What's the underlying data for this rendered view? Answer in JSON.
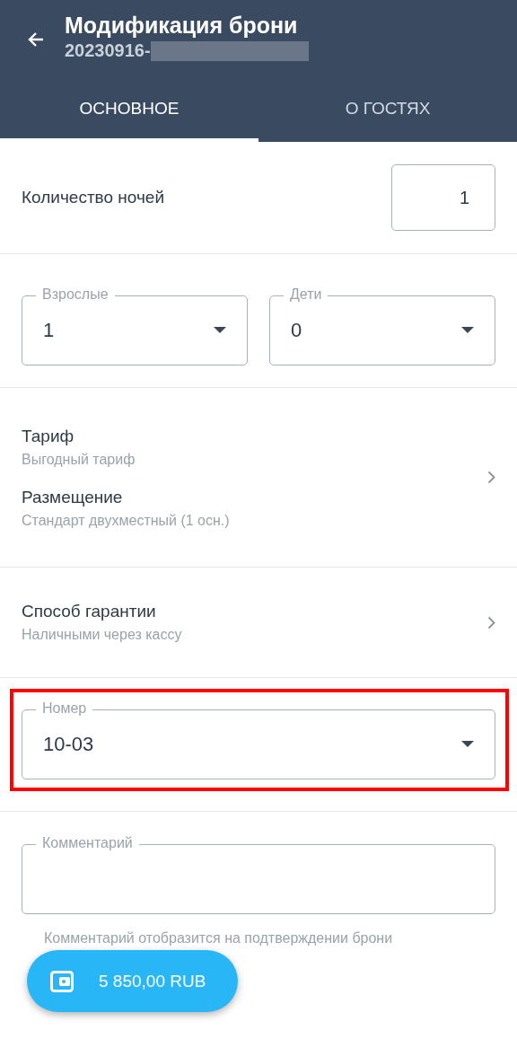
{
  "header": {
    "title": "Модификация брони",
    "subtitle": "20230916-"
  },
  "tabs": [
    {
      "label": "ОСНОВНОЕ",
      "selected": true
    },
    {
      "label": "О ГОСТЯХ",
      "selected": false
    }
  ],
  "nights": {
    "label": "Количество ночей",
    "value": "1"
  },
  "guests": [
    {
      "label": "Взрослые",
      "value": "1"
    },
    {
      "label": "Дети",
      "value": "0"
    }
  ],
  "rate_section": {
    "items": [
      {
        "label": "Тариф",
        "value": "Выгодный тариф"
      },
      {
        "label": "Размещение",
        "value": "Стандарт двухместный (1 осн.)"
      }
    ]
  },
  "guarantee_section": {
    "items": [
      {
        "label": "Способ гарантии",
        "value": "Наличными через кассу"
      }
    ]
  },
  "room": {
    "label": "Номер",
    "value": "10-03",
    "highlighted": true
  },
  "comment": {
    "label": "Комментарий",
    "helper": "Комментарий отобразится на подтверждении брони"
  },
  "total_button": {
    "label": "5 850,00 RUB"
  }
}
